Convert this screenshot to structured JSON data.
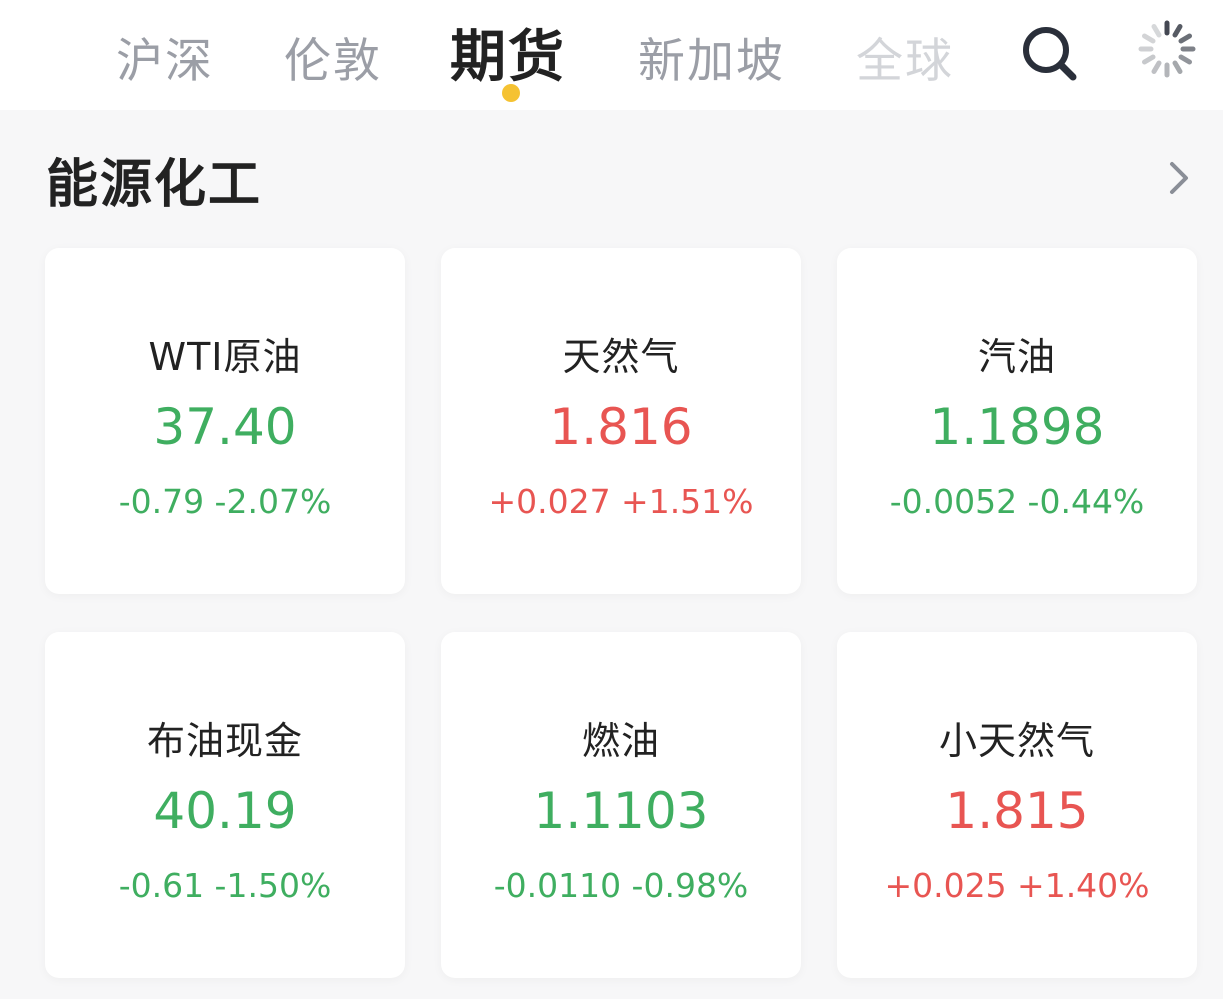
{
  "tabs": [
    {
      "label": "沪深",
      "state": "normal"
    },
    {
      "label": "伦敦",
      "state": "normal"
    },
    {
      "label": "期货",
      "state": "active"
    },
    {
      "label": "新加坡",
      "state": "normal"
    },
    {
      "label": "全球",
      "state": "faded"
    }
  ],
  "icons": {
    "search": "search-icon",
    "loading": "loading-spinner-icon",
    "more": "chevron-right-icon"
  },
  "colors": {
    "up": "#e85552",
    "down": "#3fae60",
    "active_dot": "#f5c232"
  },
  "section": {
    "title": "能源化工"
  },
  "cards": [
    {
      "name": "WTI原油",
      "price": "37.40",
      "change": "-0.79 -2.07%",
      "trend": "down"
    },
    {
      "name": "天然气",
      "price": "1.816",
      "change": "+0.027 +1.51%",
      "trend": "up"
    },
    {
      "name": "汽油",
      "price": "1.1898",
      "change": "-0.0052 -0.44%",
      "trend": "down"
    },
    {
      "name": "布油现金",
      "price": "40.19",
      "change": "-0.61 -1.50%",
      "trend": "down"
    },
    {
      "name": "燃油",
      "price": "1.1103",
      "change": "-0.0110 -0.98%",
      "trend": "down"
    },
    {
      "name": "小天然气",
      "price": "1.815",
      "change": "+0.025 +1.40%",
      "trend": "up"
    }
  ]
}
